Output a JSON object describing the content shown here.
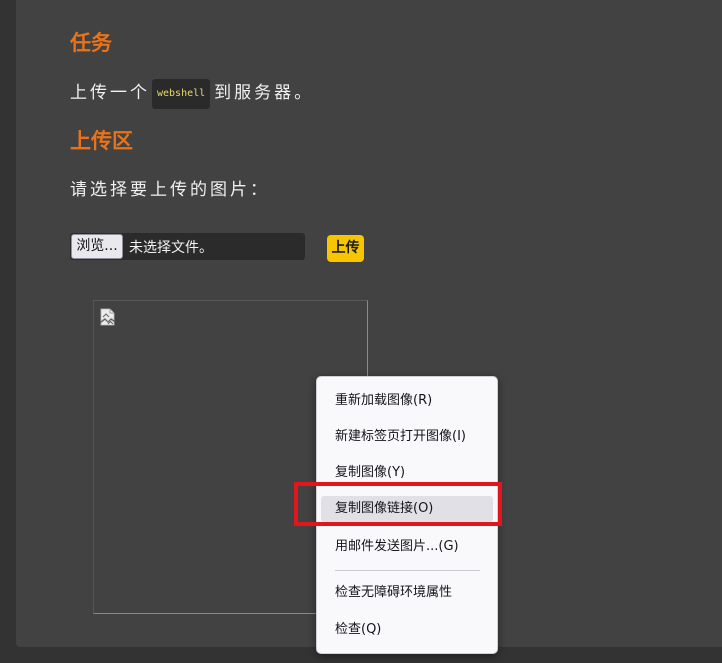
{
  "task": {
    "heading": "任务",
    "text_before": "上传一个",
    "code": "webshell",
    "text_after": "到服务器。"
  },
  "upload": {
    "heading": "上传区",
    "prompt": "请选择要上传的图片：",
    "browse_label": "浏览...",
    "no_file_text": "未选择文件。",
    "submit_label": "上传"
  },
  "context_menu": {
    "items": [
      "重新加载图像(R)",
      "新建标签页打开图像(I)",
      "复制图像(Y)",
      "复制图像链接(O)",
      "用邮件发送图片...(G)",
      "检查无障碍环境属性",
      "检查(Q)"
    ],
    "hovered_index": 3
  },
  "colors": {
    "heading": "#e8731a",
    "submit_button": "#f7c600",
    "highlight_box": "#e0161c",
    "code_text": "#e5d96a"
  },
  "icons": {
    "broken_image": "broken-image-icon"
  }
}
